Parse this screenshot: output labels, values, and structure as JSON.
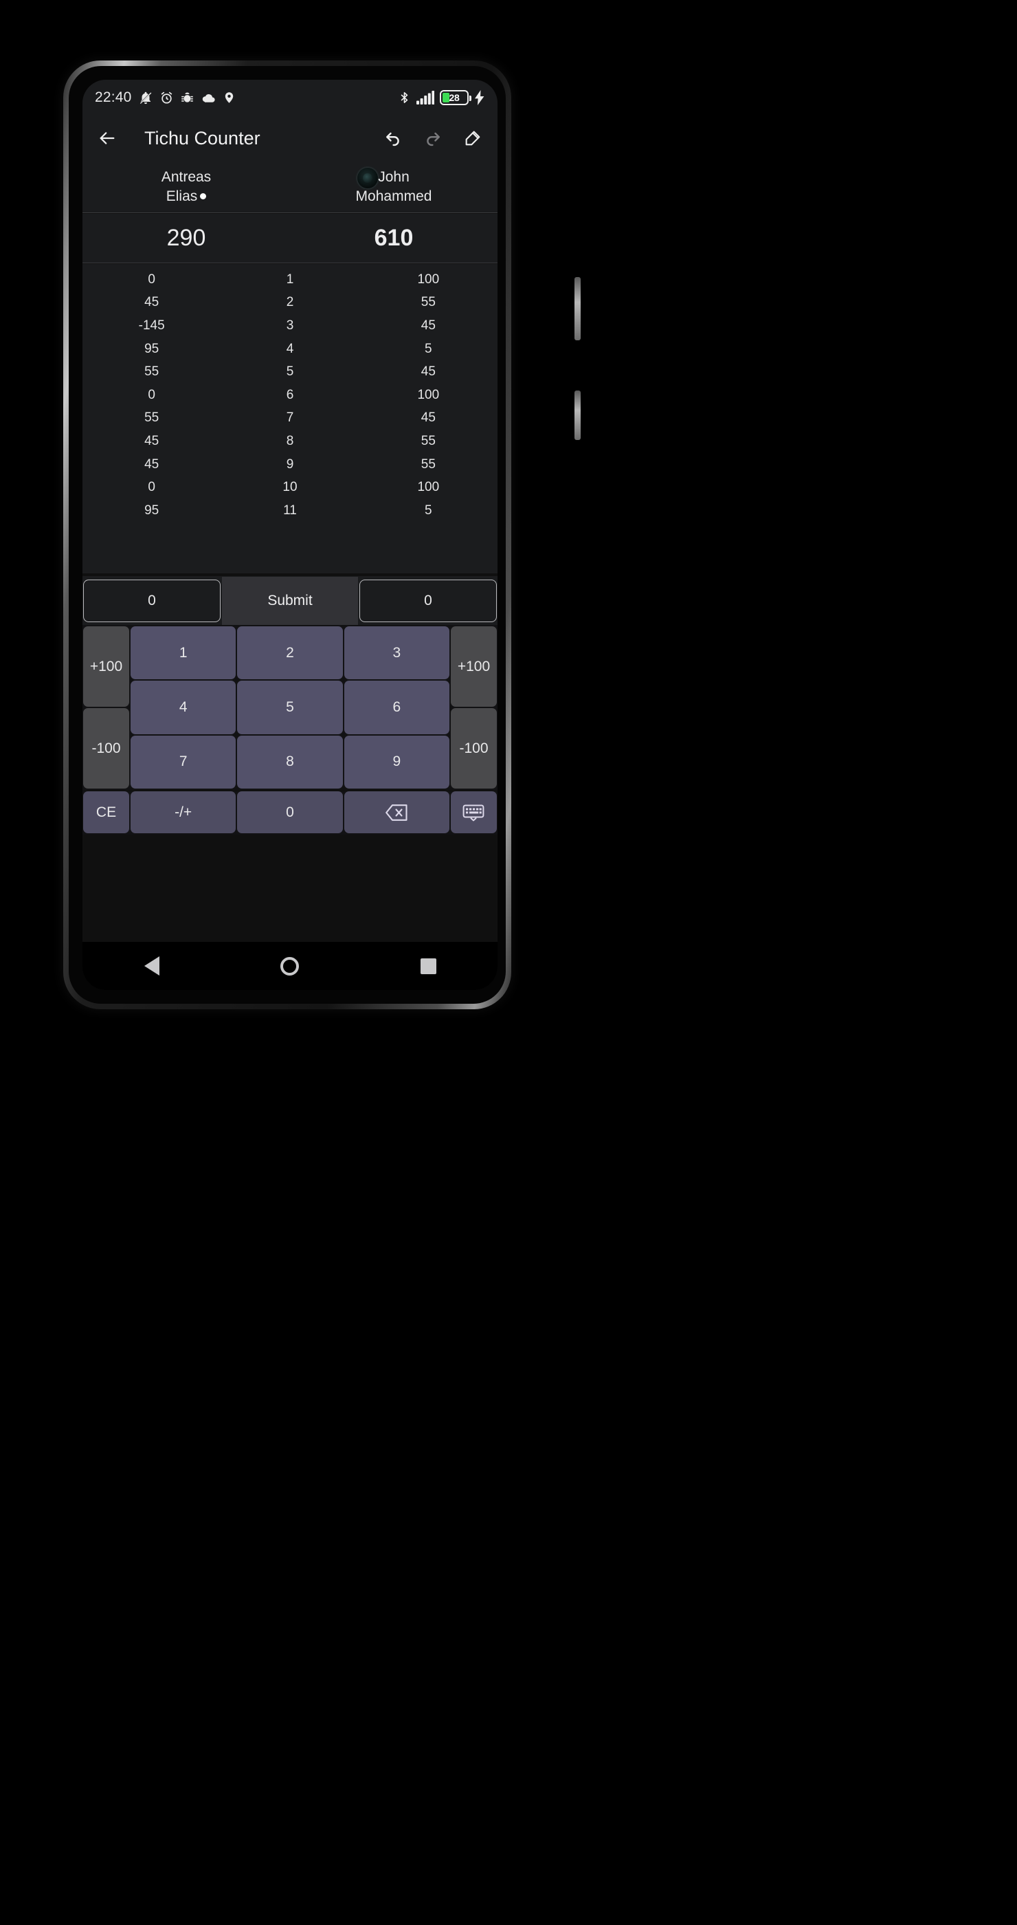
{
  "status_bar": {
    "clock": "22:40",
    "left_icons": [
      "silent-mode-icon",
      "alarm-icon",
      "debug-bug-icon",
      "cloud-icon",
      "location-pin-icon"
    ],
    "right_icons": [
      "bluetooth-icon",
      "signal-bars-icon",
      "battery-icon",
      "charging-bolt-icon"
    ],
    "battery_level": "28",
    "battery_color": "#3ddc54"
  },
  "app_bar": {
    "title": "Tichu Counter",
    "back_icon": "back-arrow-icon",
    "undo_icon": "undo-icon",
    "redo_icon": "redo-icon",
    "edit_icon": "edit-pencil-icon"
  },
  "teams": [
    {
      "player_1": "Antreas",
      "player_2": "Elias",
      "active_marker": true,
      "total": "290",
      "is_leader": false
    },
    {
      "player_1": "John",
      "player_2": "Mohammed",
      "active_marker": false,
      "total": "610",
      "is_leader": true
    }
  ],
  "score_table": {
    "rounds": [
      {
        "left": "0",
        "round": "1",
        "right": "100"
      },
      {
        "left": "45",
        "round": "2",
        "right": "55"
      },
      {
        "left": "-145",
        "round": "3",
        "right": "45"
      },
      {
        "left": "95",
        "round": "4",
        "right": "5"
      },
      {
        "left": "55",
        "round": "5",
        "right": "45"
      },
      {
        "left": "0",
        "round": "6",
        "right": "100"
      },
      {
        "left": "55",
        "round": "7",
        "right": "45"
      },
      {
        "left": "45",
        "round": "8",
        "right": "55"
      },
      {
        "left": "45",
        "round": "9",
        "right": "55"
      },
      {
        "left": "0",
        "round": "10",
        "right": "100"
      },
      {
        "left": "95",
        "round": "11",
        "right": "5"
      }
    ]
  },
  "input_row": {
    "left_value": "0",
    "right_value": "0",
    "submit_label": "Submit"
  },
  "keypad": {
    "left_column": [
      "+100",
      "-100"
    ],
    "right_column": [
      "+100",
      "-100"
    ],
    "digits_row_1": [
      "1",
      "2",
      "3"
    ],
    "digits_row_2": [
      "4",
      "5",
      "6"
    ],
    "digits_row_3": [
      "7",
      "8",
      "9"
    ],
    "bottom": {
      "clear": "CE",
      "sign": "-/+",
      "zero": "0",
      "backspace_icon": "backspace-icon",
      "keyboard_icon": "keyboard-icon"
    },
    "colors": {
      "digit_key": "#53516a",
      "modifier_key": "#4a4a4c",
      "function_key": "#4e4c62"
    }
  },
  "nav_bar": {
    "back_icon": "nav-back-triangle-icon",
    "home_icon": "nav-home-circle-icon",
    "recents_icon": "nav-recents-square-icon"
  }
}
